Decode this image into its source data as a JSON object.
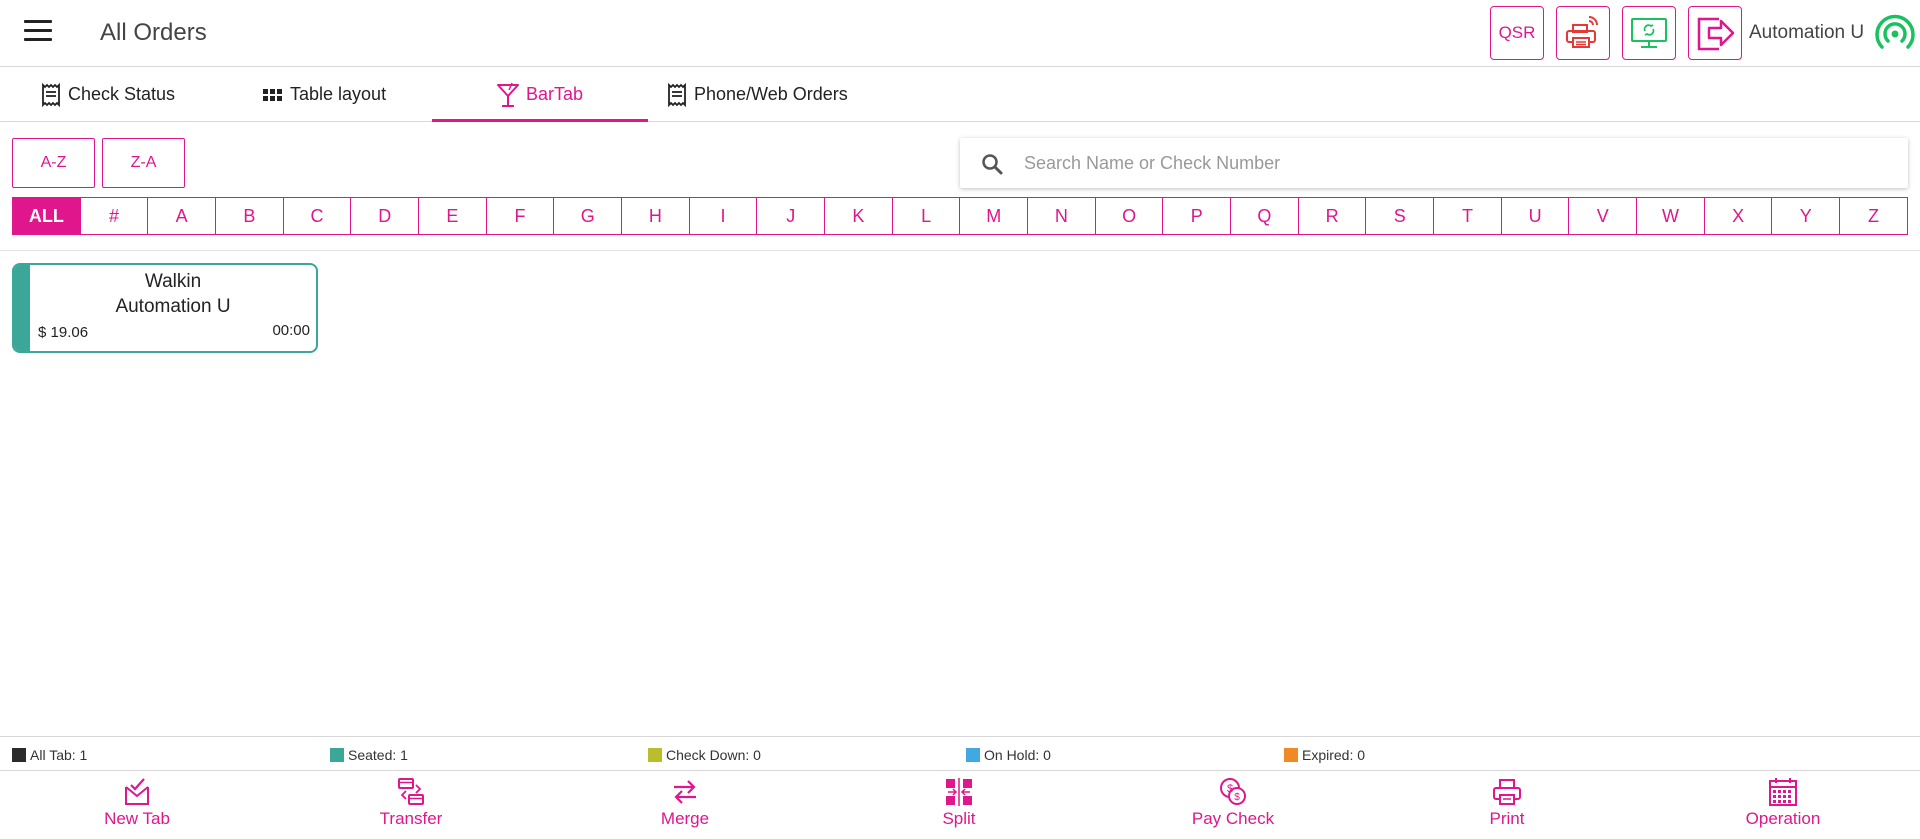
{
  "header": {
    "title": "All Orders",
    "qsr_label": "QSR",
    "user_name": "Automation U"
  },
  "tabs": [
    {
      "label": "Check Status",
      "icon": "receipt-icon"
    },
    {
      "label": "Table layout",
      "icon": "grid-icon"
    },
    {
      "label": "BarTab",
      "icon": "cocktail-icon",
      "active": true
    },
    {
      "label": "Phone/Web Orders",
      "icon": "receipt-icon"
    }
  ],
  "sort": {
    "az_label": "A-Z",
    "za_label": "Z-A"
  },
  "search": {
    "placeholder": "Search Name or Check Number",
    "value": ""
  },
  "alphabet": [
    "ALL",
    "#",
    "A",
    "B",
    "C",
    "D",
    "E",
    "F",
    "G",
    "H",
    "I",
    "J",
    "K",
    "L",
    "M",
    "N",
    "O",
    "P",
    "Q",
    "R",
    "S",
    "T",
    "U",
    "V",
    "W",
    "X",
    "Y",
    "Z"
  ],
  "alphabet_selected": "ALL",
  "checks": [
    {
      "name": "Walkin",
      "server": "Automation U",
      "amount": "$ 19.06",
      "time": "00:00",
      "status": "seated"
    }
  ],
  "legend": [
    {
      "label": "All Tab: 1",
      "color": "#2b2b2b"
    },
    {
      "label": "Seated: 1",
      "color": "#3aa798"
    },
    {
      "label": "Check Down: 0",
      "color": "#b9bf2c"
    },
    {
      "label": "On Hold: 0",
      "color": "#3fa9e0"
    },
    {
      "label": "Expired: 0",
      "color": "#f08a24"
    }
  ],
  "toolbar": [
    {
      "label": "New Tab",
      "icon": "new-tab-icon"
    },
    {
      "label": "Transfer",
      "icon": "transfer-icon"
    },
    {
      "label": "Merge",
      "icon": "merge-icon"
    },
    {
      "label": "Split",
      "icon": "split-icon"
    },
    {
      "label": "Pay Check",
      "icon": "pay-check-icon"
    },
    {
      "label": "Print",
      "icon": "print-icon"
    },
    {
      "label": "Operation",
      "icon": "calendar-icon"
    }
  ],
  "colors": {
    "accent": "#e0168d",
    "seated": "#3aa798",
    "printer": "#e53935",
    "monitor": "#19c15f",
    "signal": "#19c15f"
  }
}
